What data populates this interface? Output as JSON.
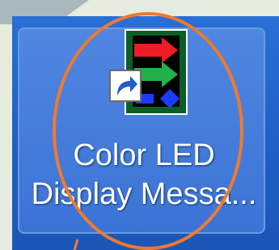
{
  "desktop": {
    "shortcut": {
      "icon": "led-display-arrows-icon",
      "overlay_icon": "shortcut-arrow-icon",
      "label_line1": "Color LED",
      "label_line2": "Display Messa..."
    }
  },
  "annotation": {
    "shape": "callout-ellipse",
    "color": "#f07a2e"
  },
  "colors": {
    "desktop_blue": "#1f5fc6",
    "selection_blue": "#4f86e0",
    "arrow_red": "#ee1c24",
    "arrow_green": "#22b14c",
    "arrow_blue": "#1a3cff"
  }
}
